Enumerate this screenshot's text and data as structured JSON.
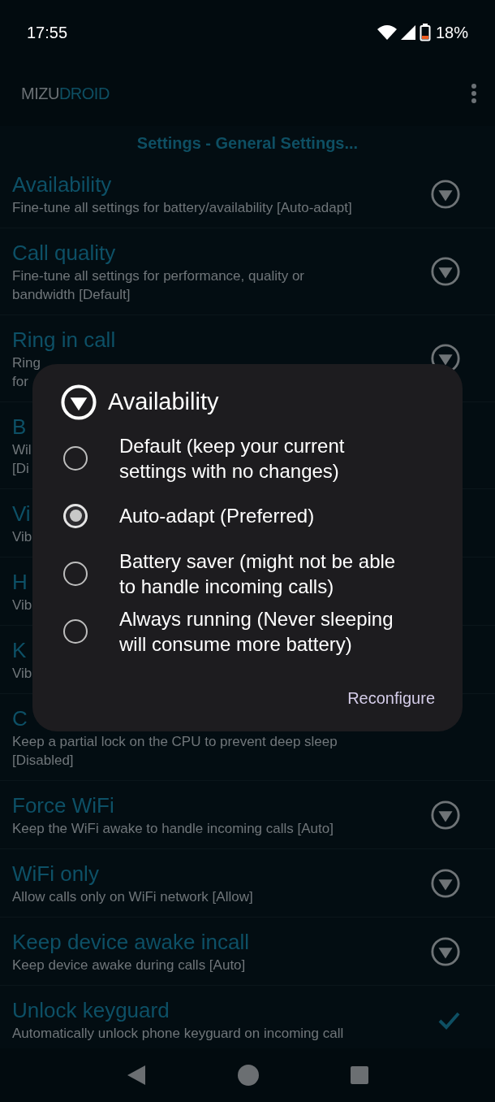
{
  "status_bar": {
    "time": "17:55",
    "battery": "18%"
  },
  "app_bar": {
    "title_start": "MIZU",
    "title_end": "DROID"
  },
  "section_header": "Settings - General Settings...",
  "settings": [
    {
      "title": "Availability",
      "lines": [
        "Fine-tune all settings for battery/availability [Auto-adapt]"
      ],
      "kind": "dropdown"
    },
    {
      "title": "Call quality",
      "lines": [
        "Fine-tune all settings for performance, quality or",
        "bandwidth [Default]"
      ],
      "kind": "dropdown"
    },
    {
      "title": "Ring in call",
      "lines": [
        "Ring",
        "for"
      ],
      "kind": "dropdown"
    },
    {
      "title": "B",
      "lines": [
        "Wil",
        "[Di"
      ]
    },
    {
      "title": "Vi",
      "lines": [
        "Vib"
      ]
    },
    {
      "title": "H",
      "lines": [
        "Vib"
      ]
    },
    {
      "title": "K",
      "lines": [
        "Vib"
      ]
    },
    {
      "title": "C",
      "lines": [
        "Keep a partial lock on the CPU to prevent deep sleep",
        "[Disabled]"
      ]
    },
    {
      "title": "Force WiFi",
      "lines": [
        "Keep the WiFi awake to handle incoming calls [Auto]"
      ],
      "kind": "dropdown"
    },
    {
      "title": "WiFi only",
      "lines": [
        "Allow calls only on WiFi network [Allow]"
      ],
      "kind": "dropdown"
    },
    {
      "title": "Keep device awake incall",
      "lines": [
        "Keep device awake during calls [Auto]"
      ],
      "kind": "dropdown"
    },
    {
      "title": "Unlock keyguard",
      "lines": [
        "Automatically unlock phone keyguard on incoming call"
      ],
      "kind": "checkbox",
      "checked": true
    }
  ],
  "dialog": {
    "title": "Availability",
    "options": [
      {
        "label": "Default (keep your current settings with no changes)",
        "selected": false
      },
      {
        "label": "Auto-adapt (Preferred)",
        "selected": true
      },
      {
        "label": "Battery saver (might not be able to handle incoming calls)",
        "selected": false
      },
      {
        "label": "Always running (Never sleeping will consume more battery)",
        "selected": false
      }
    ],
    "button": "Reconfigure"
  }
}
